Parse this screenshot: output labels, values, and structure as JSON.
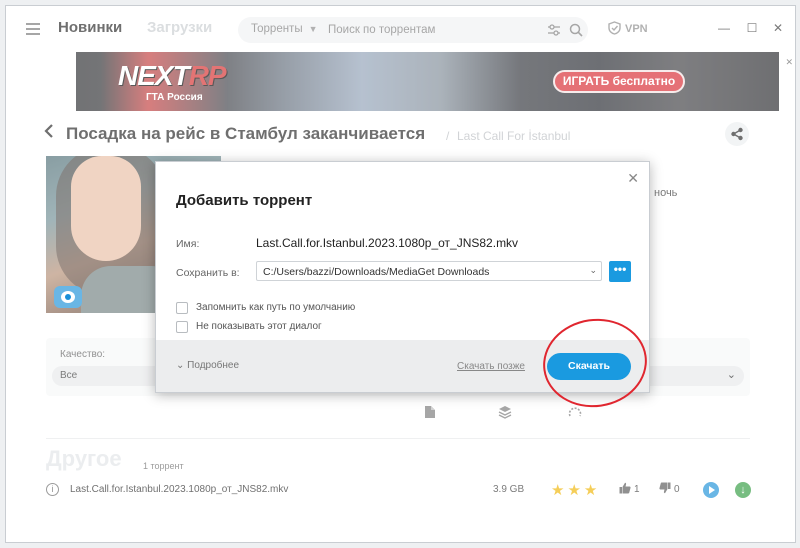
{
  "nav": {
    "tabs": [
      {
        "label": "Новинки",
        "active": true
      },
      {
        "label": "Загрузки",
        "active": false
      }
    ]
  },
  "search": {
    "category": "Торренты",
    "placeholder": "Поиск по торрентам"
  },
  "vpn": {
    "label": "VPN"
  },
  "banner": {
    "logo_main": "NEXT",
    "logo_accent": "RP",
    "subtitle": "ГТА Россия",
    "cta": "ИГРАТЬ бесплатно"
  },
  "page": {
    "title": "Посадка на рейс в Стамбул заканчивается",
    "separator": "/",
    "original_title": "Last Call For İstanbul",
    "description_peek": "ночь"
  },
  "quality": {
    "label": "Качество:",
    "value": "Все"
  },
  "section": {
    "title": "Другое",
    "count": "1 торрент"
  },
  "torrents": [
    {
      "name": "Last.Call.for.Istanbul.2023.1080p_от_JNS82.mkv",
      "size": "3.9 GB",
      "stars": 3,
      "likes": "1",
      "dislikes": "0"
    }
  ],
  "dialog": {
    "title": "Добавить торрент",
    "name_label": "Имя:",
    "name_value": "Last.Call.for.Istanbul.2023.1080p_от_JNS82.mkv",
    "path_label": "Сохранить в:",
    "path_value": "C:/Users/bazzi/Downloads/MediaGet Downloads",
    "browse_label": "•••",
    "options": [
      {
        "label": "Запомнить как путь по умолчанию",
        "checked": false
      },
      {
        "label": "Не показывать этот диалог",
        "checked": false
      }
    ],
    "more_label": "Подробнее",
    "later_label": "Скачать позже",
    "download_label": "Скачать"
  },
  "colors": {
    "accent": "#1a9ae0",
    "brand_red": "#d8262d",
    "annotation_red": "#e0262f",
    "star": "#f0b400",
    "download_green": "#2e9a3e"
  }
}
